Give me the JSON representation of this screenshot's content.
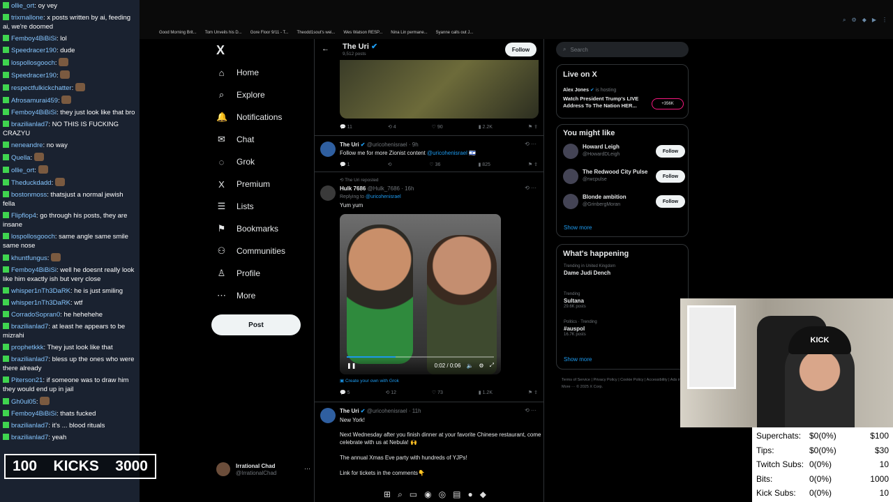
{
  "chat": [
    {
      "user": "ollie_ort",
      "text": "oy vey"
    },
    {
      "user": "trixmallone",
      "text": "x posts written by ai, feeding ai, we're doomed"
    },
    {
      "user": "Femboy4BiBiSi",
      "text": "lol"
    },
    {
      "user": "Speedracer190",
      "text": "dude"
    },
    {
      "user": "lospollosgooch",
      "text": ""
    },
    {
      "user": "Speedracer190",
      "text": ""
    },
    {
      "user": "respectfulkickchatter",
      "text": ""
    },
    {
      "user": "Afrosamurai459",
      "text": ""
    },
    {
      "user": "Femboy4BiBiSi",
      "text": "they just look like that bro"
    },
    {
      "user": "brazilianlad7",
      "text": "NO THIS IS FUCKING CRAZYU"
    },
    {
      "user": "neneandre",
      "text": "no way"
    },
    {
      "user": "Quella",
      "text": ""
    },
    {
      "user": "ollie_ort",
      "text": ""
    },
    {
      "user": "Theduckdadd",
      "text": ""
    },
    {
      "user": "bostonmoss",
      "text": "thatsjust a normal jewish fella"
    },
    {
      "user": "Flipflop4",
      "text": "go through his posts, they are insane"
    },
    {
      "user": "lospollosgooch",
      "text": "same angle same smile same nose"
    },
    {
      "user": "khuntfungus",
      "text": ""
    },
    {
      "user": "Femboy4BiBiSi",
      "text": "well he doesnt really look like him exactly ish but very close"
    },
    {
      "user": "whisper1nTh3DaRK",
      "text": "he is just smiling"
    },
    {
      "user": "whisper1nTh3DaRK",
      "text": "wtf"
    },
    {
      "user": "CorradoSopran0",
      "text": "he hehehehe"
    },
    {
      "user": "brazilianlad7",
      "text": "at least he appears to be mizrahi"
    },
    {
      "user": "prophetkkk",
      "text": "They just look like that"
    },
    {
      "user": "brazilianlad7",
      "text": "bless up the ones who were there already"
    },
    {
      "user": "Piterson21",
      "text": "if someone was to draw him they would end up in jail"
    },
    {
      "user": "Gh0ul05",
      "text": ""
    },
    {
      "user": "Femboy4BiBiSi",
      "text": "thats fucked"
    },
    {
      "user": "brazilianlad7",
      "text": "it's ... blood rituals"
    },
    {
      "user": "brazilianlad7",
      "text": "yeah"
    }
  ],
  "kicks": {
    "left": "100",
    "label": "KICKS",
    "right": "3000"
  },
  "bookmarks": [
    "Good Morning Brit...",
    "Tom Unveils his D...",
    "Gore Floor 9/11 - T...",
    "Theodd1sout's wei...",
    "Wes Watson RESP...",
    "Nina Lin permane...",
    "Syanne calls out J..."
  ],
  "nav": {
    "logo": "X",
    "items": [
      {
        "label": "Home",
        "icon": "⌂"
      },
      {
        "label": "Explore",
        "icon": "⌕"
      },
      {
        "label": "Notifications",
        "icon": "🔔"
      },
      {
        "label": "Chat",
        "icon": "✉"
      },
      {
        "label": "Grok",
        "icon": "◌"
      },
      {
        "label": "Premium",
        "icon": "X"
      },
      {
        "label": "Lists",
        "icon": "☰"
      },
      {
        "label": "Bookmarks",
        "icon": "⚑"
      },
      {
        "label": "Communities",
        "icon": "⚇"
      },
      {
        "label": "Profile",
        "icon": "♙"
      },
      {
        "label": "More",
        "icon": "⋯"
      }
    ],
    "post": "Post",
    "account": {
      "name": "Irrational Chad",
      "handle": "@IrrationalChad",
      "more": "···"
    }
  },
  "timeline": {
    "header": {
      "name": "The Uri",
      "posts": "9,512 posts",
      "follow": "Follow",
      "back": "←"
    },
    "first_actions": [
      "11",
      "4",
      "90",
      "2.2K"
    ],
    "tweet1": {
      "name": "The Uri",
      "handle": "@uricohenisrael · 9h",
      "text": "Follow me for more Zionist content",
      "mention": "@uricohenisrael 🇮🇱",
      "actions": [
        "1",
        "",
        "36",
        "825"
      ]
    },
    "tweet2": {
      "reposted": "The Uri reposted",
      "name": "Hulk 7686",
      "handle": "@Hulk_7686 · 16h",
      "replying": "Replying to",
      "replying_to": "@uricohenisrael",
      "text": "Yum yum",
      "time": "0:02 / 0:06",
      "progress": 0.33,
      "grok": "Create your own with Grok",
      "actions": [
        "5",
        "12",
        "73",
        "1.2K"
      ]
    },
    "tweet3": {
      "name": "The Uri",
      "handle": "@uricohenisrael · 11h",
      "line1": "New York!",
      "line2": "Next Wednesday after you finish dinner at your favorite Chinese restaurant, come celebrate with us at Nebula! 🙌",
      "line3": "The annual Xmas Eve party with hundreds of YJPs!",
      "line4": "Link for tickets in the comments👇"
    }
  },
  "right": {
    "search": "Search",
    "live_title": "Live on X",
    "live_host": "Alex Jones",
    "live_hosting": "is hosting",
    "live_text": "Watch President Trump's LIVE Address To The Nation HER...",
    "live_count": "+356K",
    "you_might_like": "You might like",
    "suggestions": [
      {
        "name": "Howard Leigh",
        "handle": "@HowardDLeigh",
        "follow": "Follow"
      },
      {
        "name": "The Redwood City Pulse",
        "handle": "@rwcpulse",
        "follow": "Follow"
      },
      {
        "name": "Blonde ambition",
        "handle": "@GrinbergMoran",
        "follow": "Follow"
      }
    ],
    "show_more": "Show more",
    "happening_title": "What's happening",
    "trends": [
      {
        "context": "Trending in United Kingdom",
        "topic": "Dame Judi Dench",
        "posts": ""
      },
      {
        "context": "Trending",
        "topic": "Sultana",
        "posts": "29.6K posts"
      },
      {
        "context": "Politics · Trending",
        "topic": "#auspol",
        "posts": "16.7K posts"
      }
    ],
    "footer": "Terms of Service  |  Privacy Policy  |  Cookie Policy  |  Accessibility  |  Ads info  |  More ···  © 2025 X Corp."
  },
  "webcam": {
    "cap_text": "KICK"
  },
  "stats": [
    {
      "label": "Superchats:",
      "value": "$0(0%)",
      "goal": "$100"
    },
    {
      "label": "Tips:",
      "value": "$0(0%)",
      "goal": "$30"
    },
    {
      "label": "Twitch Subs:",
      "value": "0(0%)",
      "goal": "10"
    },
    {
      "label": "Bits:",
      "value": "0(0%)",
      "goal": "1000"
    },
    {
      "label": "Kick Subs:",
      "value": "0(0%)",
      "goal": "10"
    }
  ]
}
